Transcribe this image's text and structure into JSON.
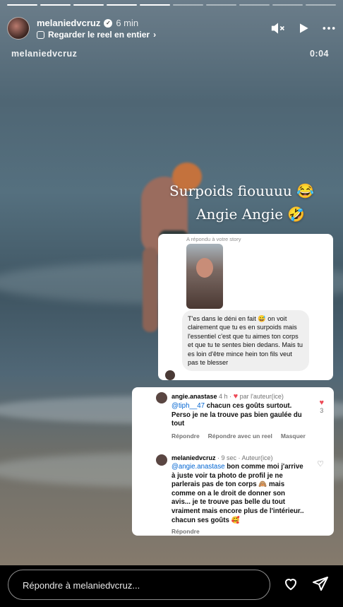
{
  "story": {
    "username": "melaniedvcruz",
    "time": "6 min",
    "reel_link": "Regarder le reel en entier",
    "overlay_username": "melaniedvcruz",
    "overlay_timer": "0:04",
    "progress_total": 10,
    "progress_done": 5
  },
  "captions": {
    "line1": "Surpoids fiouuuu 😂",
    "line2": "Angie Angie 🤣"
  },
  "dm": {
    "replied_label": "A répondu à votre story",
    "message": "T'es dans le déni en fait 😅 on voit clairement que tu es en surpoids mais l'essentiel c'est que tu aimes ton corps et que tu te sentes bien dedans. Mais tu es loin d'être mince hein ton fils veut pas te blesser"
  },
  "comments": [
    {
      "user": "angie.anastase",
      "meta": " 4 h · ",
      "liked_by_author": "par l'auteur(ice)",
      "mention": "@tiph__47",
      "text": " chacun ces goûts surtout. Perso je ne la trouve pas bien gaulée du tout",
      "actions": [
        "Répondre",
        "Répondre avec un reel",
        "Masquer"
      ],
      "like_count": "3"
    },
    {
      "user": "melaniedvcruz",
      "meta": " · 9 sec · Auteur(ice)",
      "mention": "@angie.anastase",
      "text": " bon comme moi j'arrive à juste voir ta photo de profil je ne parlerais pas de ton corps 🙈 mais comme on a le droit de donner son avis... je te trouve pas belle du tout vraiment mais encore plus de l'intérieur.. chacun ses goûts 🥰",
      "actions": [
        "Répondre"
      ]
    }
  ],
  "reply": {
    "placeholder": "Répondre à melaniedvcruz..."
  },
  "icons": {
    "header": [
      "mute-icon",
      "play-icon",
      "more-icon"
    ],
    "bottom": [
      "heart-icon",
      "send-icon"
    ]
  }
}
